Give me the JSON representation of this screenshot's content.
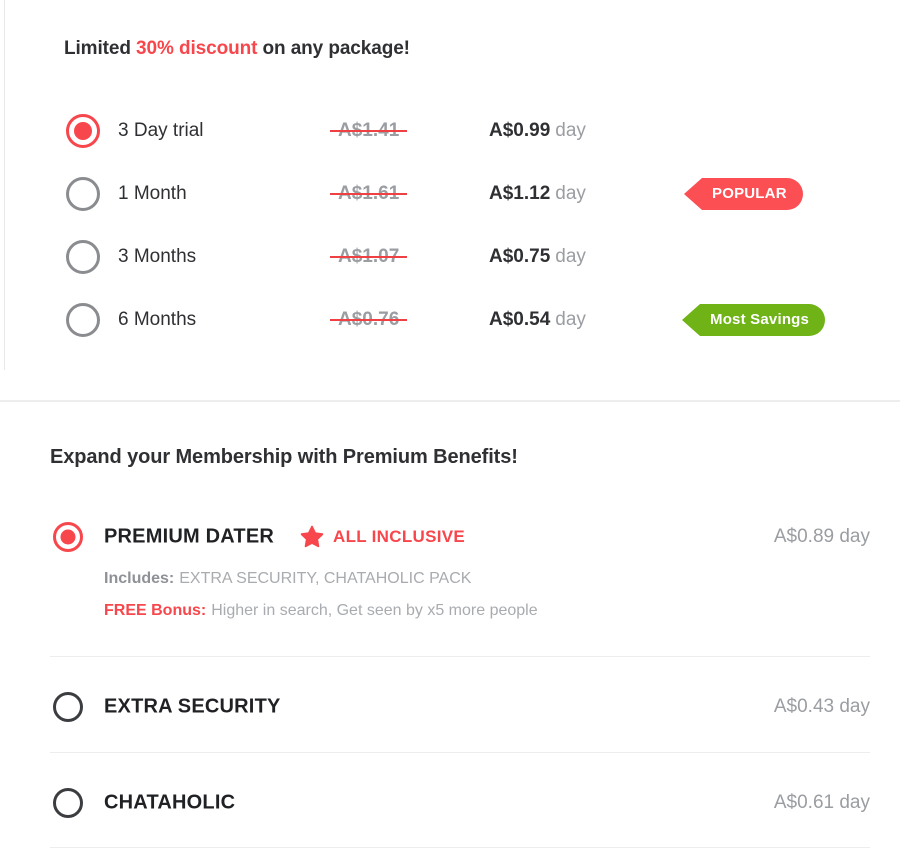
{
  "packages_section": {
    "headline": {
      "prefix": "Limited ",
      "accent": "30% discount",
      "suffix": " on any package!"
    },
    "rows": [
      {
        "name": "3 Day trial",
        "old_price": "A$1.41",
        "new_price": "A$0.99",
        "per": "day",
        "selected": true,
        "badge": null
      },
      {
        "name": "1 Month",
        "old_price": "A$1.61",
        "new_price": "A$1.12",
        "per": "day",
        "selected": false,
        "badge": {
          "label": "POPULAR",
          "color": "#fb4f54"
        }
      },
      {
        "name": "3 Months",
        "old_price": "A$1.07",
        "new_price": "A$0.75",
        "per": "day",
        "selected": false,
        "badge": null
      },
      {
        "name": "6 Months",
        "old_price": "A$0.76",
        "new_price": "A$0.54",
        "per": "day",
        "selected": false,
        "badge": {
          "label": "Most Savings",
          "color": "#6fb316"
        }
      }
    ]
  },
  "premium_section": {
    "title": "Expand your Membership with Premium Benefits!",
    "rows": [
      {
        "name": "PREMIUM DATER",
        "tag": "ALL INCLUSIVE",
        "tag_icon": "star-icon",
        "price": "A$0.89 day",
        "selected": true,
        "details": [
          {
            "label": "Includes:",
            "value": "EXTRA SECURITY,  CHATAHOLIC PACK",
            "label_color": "#8e9196"
          },
          {
            "label": "FREE Bonus:",
            "value": "Higher in search,  Get seen by x5 more people",
            "label_color": "#f8474c"
          }
        ]
      },
      {
        "name": "EXTRA SECURITY",
        "price": "A$0.43 day",
        "selected": false
      },
      {
        "name": "CHATAHOLIC",
        "price": "A$0.61 day",
        "selected": false
      }
    ]
  },
  "theme": {
    "accent_red": "#f8474c",
    "badge_red": "#fb4f54",
    "badge_green": "#6fb316",
    "text_dark": "#2f3033",
    "text_muted": "#9a9da1",
    "divider": "#ededed"
  }
}
